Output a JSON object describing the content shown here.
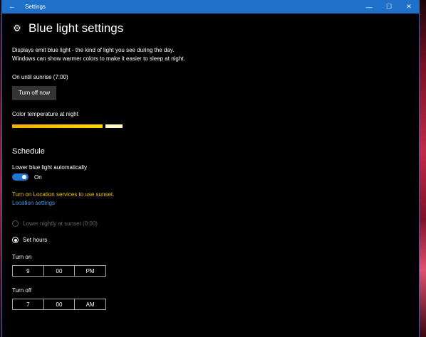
{
  "titlebar": {
    "back_icon": "back-arrow-icon",
    "app_title": "Settings",
    "minimize_symbol": "—",
    "maximize_symbol": "☐",
    "close_symbol": "✕"
  },
  "header": {
    "icon": "gear-icon",
    "title": "Blue light settings"
  },
  "description": "Displays emit blue light - the kind of light you see during the day. Windows can show warmer colors to make it easier to sleep at night.",
  "status": "On until sunrise (7:00)",
  "turn_off_button": "Turn off now",
  "color_temperature": {
    "label": "Color temperature at night",
    "level": 0.82,
    "colors": {
      "warm": "#f2b000",
      "mid": "#ffd700",
      "rest": "#fff8c0"
    }
  },
  "schedule": {
    "title": "Schedule",
    "toggle_label": "Lower blue light automatically",
    "toggle_state": "On",
    "warning": "Turn on Location services to use sunset.",
    "location_link": "Location settings",
    "option_sunset": "Lower nightly at sunset (0:00)",
    "option_hours": "Set hours",
    "selected": "Set hours",
    "turn_on": {
      "label": "Turn on",
      "hour": "9",
      "minute": "00",
      "ampm": "PM"
    },
    "turn_off": {
      "label": "Turn off",
      "hour": "7",
      "minute": "00",
      "ampm": "AM"
    }
  },
  "colors": {
    "accent": "#1e70c8",
    "warning": "#f0c419",
    "link": "#4a9be8",
    "background": "#000000"
  }
}
